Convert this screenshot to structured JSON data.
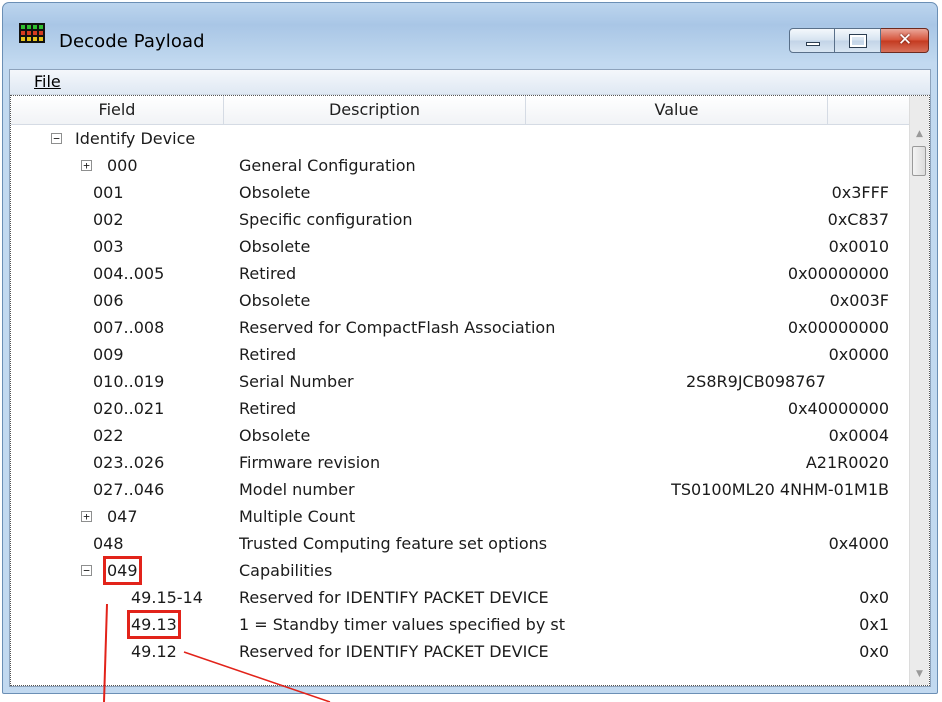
{
  "window": {
    "title": "Decode Payload",
    "controls": [
      "minimize",
      "maximize",
      "close"
    ]
  },
  "menu": {
    "file": "File"
  },
  "columns": {
    "field": "Field",
    "description": "Description",
    "value": "Value"
  },
  "rows": [
    {
      "field": "Identify Device",
      "description": "",
      "value": "",
      "expander": "minus",
      "level": 0
    },
    {
      "field": "000",
      "description": "General Configuration",
      "value": "",
      "expander": "plus",
      "level": 1
    },
    {
      "field": "001",
      "description": "Obsolete",
      "value": "0x3FFF",
      "level": 1
    },
    {
      "field": "002",
      "description": "Specific configuration",
      "value": "0xC837",
      "level": 1
    },
    {
      "field": "003",
      "description": "Obsolete",
      "value": "0x0010",
      "level": 1
    },
    {
      "field": "004..005",
      "description": "Retired",
      "value": "0x00000000",
      "level": 1
    },
    {
      "field": "006",
      "description": "Obsolete",
      "value": "0x003F",
      "level": 1
    },
    {
      "field": "007..008",
      "description": "Reserved for CompactFlash Association",
      "value": "0x00000000",
      "level": 1
    },
    {
      "field": "009",
      "description": "Retired",
      "value": "0x0000",
      "level": 1
    },
    {
      "field": "010..019",
      "description": "Serial Number",
      "value": "2S8R9JCB098767",
      "level": 1,
      "value_center": true
    },
    {
      "field": "020..021",
      "description": "Retired",
      "value": "0x40000000",
      "level": 1
    },
    {
      "field": "022",
      "description": "Obsolete",
      "value": "0x0004",
      "level": 1
    },
    {
      "field": "023..026",
      "description": "Firmware revision",
      "value": "A21R0020",
      "level": 1
    },
    {
      "field": "027..046",
      "description": "Model number",
      "value": "TS0100ML20 4NHM-01M1B",
      "level": 1
    },
    {
      "field": "047",
      "description": "Multiple Count",
      "value": "",
      "expander": "plus",
      "level": 1
    },
    {
      "field": "048",
      "description": "Trusted Computing  feature set options",
      "value": "0x4000",
      "level": 1
    },
    {
      "field": "049",
      "description": "Capabilities",
      "value": "",
      "expander": "minus",
      "level": 1
    },
    {
      "field": "49.15-14",
      "description": "Reserved for IDENTIFY PACKET DEVICE",
      "value": "0x0",
      "level": 2
    },
    {
      "field": "49.13",
      "description": "1 = Standby timer values specified by st",
      "value": "0x1",
      "level": 2
    },
    {
      "field": "49.12",
      "description": "Reserved for IDENTIFY PACKET DEVICE",
      "value": "0x0",
      "level": 2
    }
  ],
  "highlighted_fields": [
    "049",
    "49.13"
  ],
  "colors": {
    "highlight": "#e2231a",
    "titlebar": "#bcd5ee",
    "close_button": "#c43a20"
  },
  "icons": {
    "app": "decode-payload-app-icon",
    "expand": "plus-box-icon",
    "collapse": "minus-box-icon",
    "scroll_up": "triangle-up-icon",
    "scroll_down": "triangle-down-icon"
  }
}
